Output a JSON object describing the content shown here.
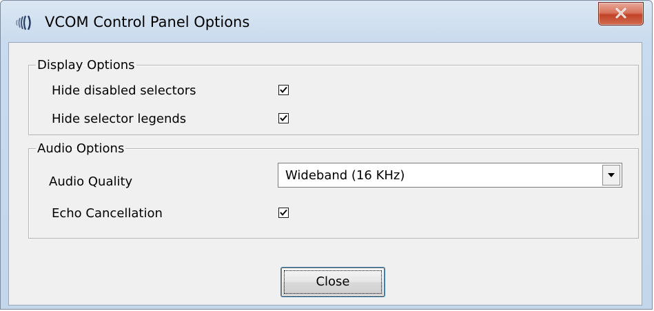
{
  "window": {
    "title": "VCOM Control Panel Options",
    "app_icon": "sound-waves-icon",
    "close_icon": "close-icon"
  },
  "display_options": {
    "legend": "Display Options",
    "items": [
      {
        "label": "Hide disabled selectors",
        "checked": true
      },
      {
        "label": "Hide selector legends",
        "checked": true
      }
    ]
  },
  "audio_options": {
    "legend": "Audio Options",
    "audio_quality": {
      "label": "Audio Quality",
      "value": "Wideband (16 KHz)",
      "dropdown_icon": "chevron-down-icon"
    },
    "echo_cancellation": {
      "label": "Echo Cancellation",
      "checked": true
    }
  },
  "buttons": {
    "close_label": "Close"
  },
  "colors": {
    "close_button": "#c2432a",
    "focus_ring": "#3c7fb1"
  }
}
